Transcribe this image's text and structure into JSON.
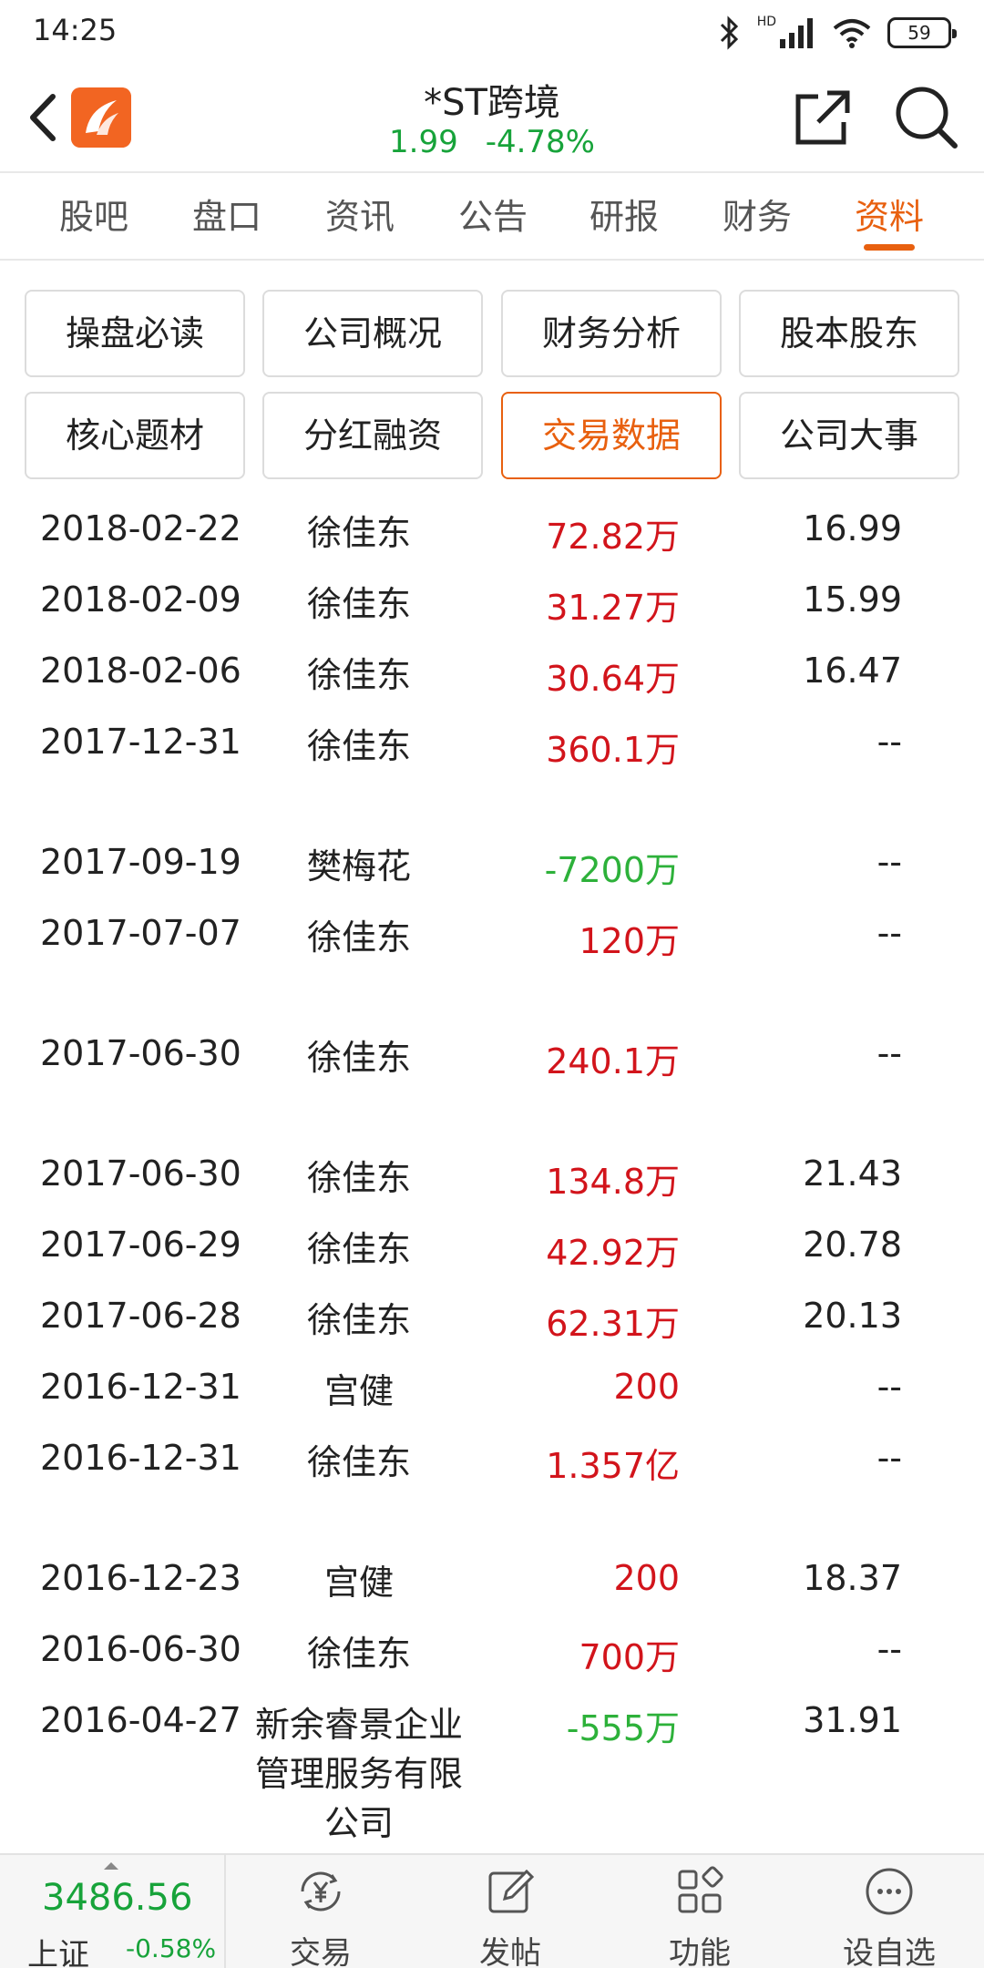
{
  "status_bar": {
    "time": "14:25",
    "network": "HD",
    "battery": "59"
  },
  "header": {
    "stock_name": "*ST跨境",
    "price": "1.99",
    "change_pct": "-4.78%"
  },
  "tabs": [
    {
      "label": "股吧",
      "active": false
    },
    {
      "label": "盘口",
      "active": false
    },
    {
      "label": "资讯",
      "active": false
    },
    {
      "label": "公告",
      "active": false
    },
    {
      "label": "研报",
      "active": false
    },
    {
      "label": "财务",
      "active": false
    },
    {
      "label": "资料",
      "active": true
    }
  ],
  "sections": [
    {
      "label": "操盘必读",
      "active": false
    },
    {
      "label": "公司概况",
      "active": false
    },
    {
      "label": "财务分析",
      "active": false
    },
    {
      "label": "股本股东",
      "active": false
    },
    {
      "label": "核心题材",
      "active": false
    },
    {
      "label": "分红融资",
      "active": false
    },
    {
      "label": "交易数据",
      "active": true
    },
    {
      "label": "公司大事",
      "active": false
    }
  ],
  "trades": [
    {
      "date": "2018-02-22",
      "name": "徐佳东",
      "amount": "72.82万",
      "amount_color": "red",
      "price": "16.99"
    },
    {
      "date": "2018-02-09",
      "name": "徐佳东",
      "amount": "31.27万",
      "amount_color": "red",
      "price": "15.99"
    },
    {
      "date": "2018-02-06",
      "name": "徐佳东",
      "amount": "30.64万",
      "amount_color": "red",
      "price": "16.47"
    },
    {
      "date": "2017-12-31",
      "name": "徐佳东",
      "amount": "360.1万",
      "amount_color": "red",
      "price": "--"
    },
    {
      "date": "2017-09-19",
      "name": "樊梅花",
      "amount": "-7200万",
      "amount_color": "green",
      "price": "--"
    },
    {
      "date": "2017-07-07",
      "name": "徐佳东",
      "amount": "120万",
      "amount_color": "red",
      "price": "--"
    },
    {
      "date": "2017-06-30",
      "name": "徐佳东",
      "amount": "240.1万",
      "amount_color": "red",
      "price": "--"
    },
    {
      "date": "2017-06-30",
      "name": "徐佳东",
      "amount": "134.8万",
      "amount_color": "red",
      "price": "21.43"
    },
    {
      "date": "2017-06-29",
      "name": "徐佳东",
      "amount": "42.92万",
      "amount_color": "red",
      "price": "20.78"
    },
    {
      "date": "2017-06-28",
      "name": "徐佳东",
      "amount": "62.31万",
      "amount_color": "red",
      "price": "20.13"
    },
    {
      "date": "2016-12-31",
      "name": "宫健",
      "amount": "200",
      "amount_color": "red",
      "price": "--"
    },
    {
      "date": "2016-12-31",
      "name": "徐佳东",
      "amount": "1.357亿",
      "amount_color": "red",
      "price": "--"
    },
    {
      "date": "2016-12-23",
      "name": "宫健",
      "amount": "200",
      "amount_color": "red",
      "price": "18.37"
    },
    {
      "date": "2016-06-30",
      "name": "徐佳东",
      "amount": "700万",
      "amount_color": "red",
      "price": "--"
    },
    {
      "date": "2016-04-27",
      "name": "新余睿景企业管理服务有限公司",
      "amount": "-555万",
      "amount_color": "green",
      "price": "31.91"
    }
  ],
  "bottom_bar": {
    "index_value": "3486.56",
    "index_name": "上证",
    "index_change": "-0.58%",
    "nav": [
      {
        "label": "交易",
        "icon": "yen-trade-icon"
      },
      {
        "label": "发帖",
        "icon": "edit-post-icon"
      },
      {
        "label": "功能",
        "icon": "grid-function-icon"
      },
      {
        "label": "设自选",
        "icon": "more-dots-icon"
      }
    ]
  },
  "colors": {
    "accent": "#e8600f",
    "up": "#d2141b",
    "down": "#2db13a",
    "quote_green": "#17a33a"
  }
}
